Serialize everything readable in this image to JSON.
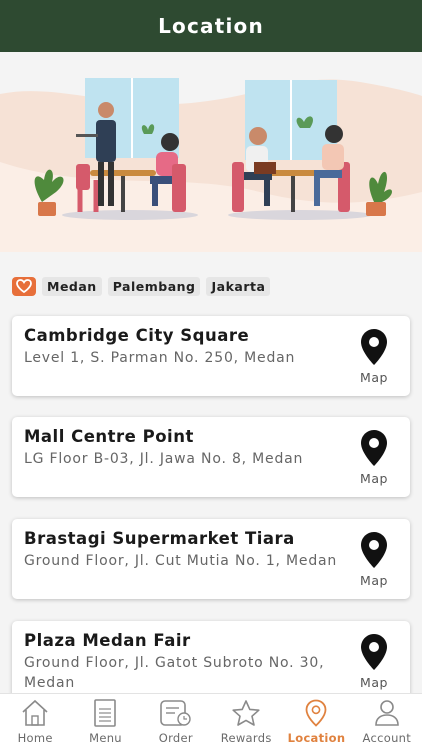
{
  "header": {
    "title": "Location"
  },
  "filters": {
    "favorites_icon": "heart-icon",
    "cities": [
      "Medan",
      "Palembang",
      "Jakarta"
    ]
  },
  "locations": [
    {
      "name": "Cambridge City Square",
      "address": "Level 1, S. Parman No. 250, Medan",
      "map_label": "Map"
    },
    {
      "name": "Mall Centre Point",
      "address": "LG Floor B-03, Jl. Jawa No. 8, Medan",
      "map_label": "Map"
    },
    {
      "name": "Brastagi Supermarket Tiara",
      "address": "Ground Floor, Jl. Cut Mutia No. 1, Medan",
      "map_label": "Map"
    },
    {
      "name": "Plaza Medan Fair",
      "address": "Ground Floor, Jl. Gatot Subroto No. 30, Medan",
      "map_label": "Map"
    }
  ],
  "tabs": [
    {
      "label": "Home",
      "icon": "home-icon"
    },
    {
      "label": "Menu",
      "icon": "menu-book-icon"
    },
    {
      "label": "Order",
      "icon": "order-icon"
    },
    {
      "label": "Rewards",
      "icon": "star-icon"
    },
    {
      "label": "Location",
      "icon": "location-pin-icon",
      "active": true
    },
    {
      "label": "Account",
      "icon": "person-icon"
    }
  ],
  "colors": {
    "header": "#2e4a31",
    "accent": "#e76f3a",
    "active_tab": "#e0823f"
  }
}
